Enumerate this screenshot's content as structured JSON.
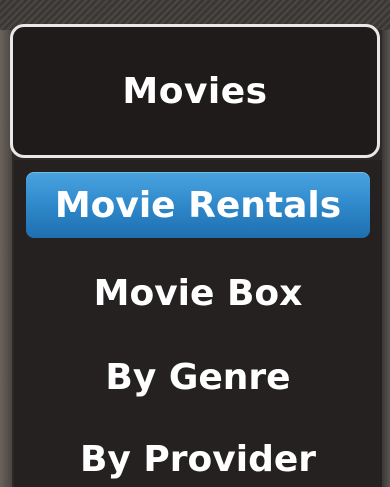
{
  "dropdown": {
    "selected_label": "Movies"
  },
  "menu": {
    "items": [
      {
        "label": "Movie Rentals",
        "selected": true
      },
      {
        "label": "Movie Box",
        "selected": false
      },
      {
        "label": "By Genre",
        "selected": false
      },
      {
        "label": "By Provider",
        "selected": false
      }
    ]
  },
  "colors": {
    "highlight": "#2d86c8",
    "background": "#252120",
    "text": "#ffffff"
  }
}
